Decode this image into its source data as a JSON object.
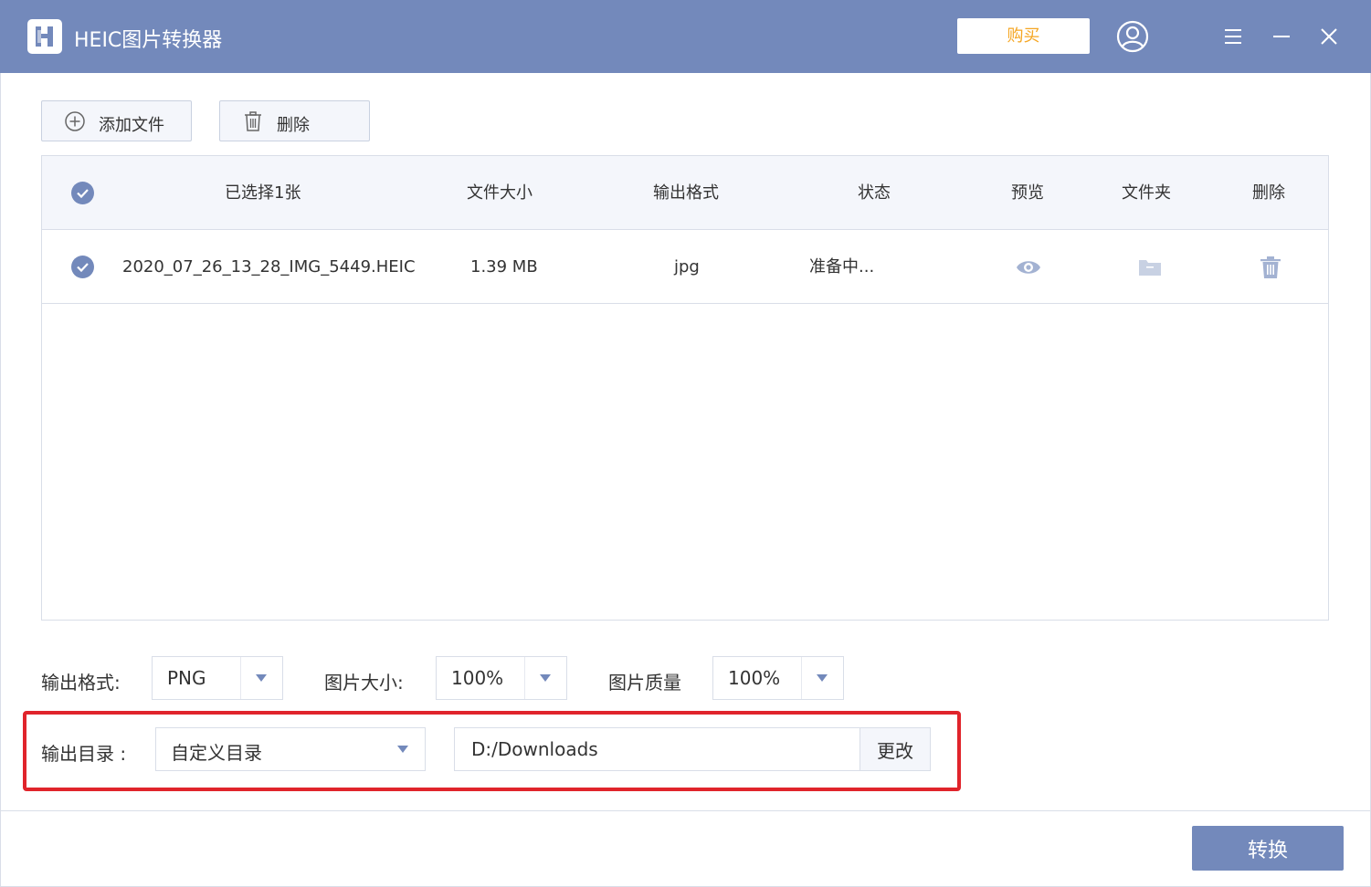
{
  "window": {
    "title": "HEIC图片转换器",
    "buy_label": "购买",
    "accent_color": "#7389bb",
    "buy_color": "#f5a623"
  },
  "toolbar": {
    "add_label": "添加文件",
    "delete_label": "删除"
  },
  "table": {
    "headers": {
      "selected": "已选择1张",
      "size": "文件大小",
      "format": "输出格式",
      "status": "状态",
      "preview": "预览",
      "folder": "文件夹",
      "delete": "删除"
    },
    "rows": [
      {
        "name": "2020_07_26_13_28_IMG_5449.HEIC",
        "size": "1.39 MB",
        "format": "jpg",
        "status": "准备中..."
      }
    ]
  },
  "settings": {
    "format_label": "输出格式:",
    "format_value": "PNG",
    "size_label": "图片大小:",
    "size_value": "100%",
    "quality_label": "图片质量",
    "quality_value": "100%",
    "dir_label": "输出目录 :",
    "dir_value": "自定义目录",
    "dir_path": "D:/Downloads",
    "change_label": "更改"
  },
  "footer": {
    "convert_label": "转换"
  }
}
